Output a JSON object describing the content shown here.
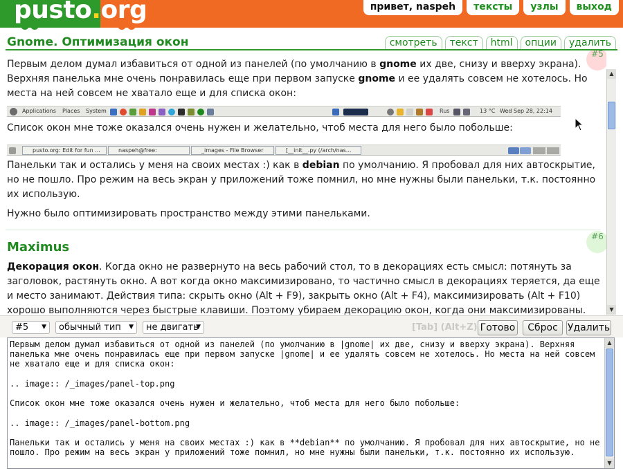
{
  "header": {
    "logo": {
      "part1": "pusto",
      "dot": ".",
      "part2": "org"
    },
    "nav": {
      "greeting": "привет, naspeh",
      "texts": "тексты",
      "nodes": "узлы",
      "logout": "выход"
    }
  },
  "doc": {
    "title": "Gnome. Оптимизация окон",
    "actions": {
      "view": "смотреть",
      "text": "текст",
      "html": "html",
      "options": "опции",
      "delete": "удалить"
    }
  },
  "content": {
    "badge5": "#5",
    "badge6": "#6",
    "p1a": "Первым делом думал избавиться от одной из панелей (по умолчанию в ",
    "p1b": "gnome",
    "p1c": " их две, снизу и вверху экрана). Верхняя панелька мне очень понравилась еще при первом запуске ",
    "p1d": "gnome",
    "p1e": " и ее удалять совсем не хотелось. Но места на ней совсем не хватало еще и для списка окон:",
    "p2": "Список окон мне тоже оказался очень нужен и желательно, чтоб места для него было побольше:",
    "p3a": "Панельки так и остались у меня на своих местах :) как в ",
    "p3b": "debian",
    "p3c": " по умолчанию. Я пробовал для них автоскрытие, но не пошло. Про режим на весь экран у приложений тоже помнил, но мне нужны были панельки, т.к. постоянно их использую.",
    "p4": "Нужно было оптимизировать пространство между этими панельками.",
    "h2": "Maximus",
    "p5a": "Декорация окон",
    "p5b": ". Когда окно не развернуто на весь рабочий стол, то в декорациях есть смысл: потянуть за заголовок, растянуть окно. А вот когда окно максимизировано, то частично смысл в декорациях теряется, да еще и место занимают. Действия типа: скрыть окно (Alt + F9), закрыть окно (Alt + F4), максимизировать (Alt + F10) хорошо выполняются через быстрые клавиши. Поэтому убираем декорацию окон, когда они максимизированы. Для этого"
  },
  "panel_top": {
    "applications": "Applications",
    "places": "Places",
    "system": "System",
    "layout": "Rus",
    "temp": "13 °C",
    "clock": "Wed Sep 28, 22:14"
  },
  "panel_bottom": {
    "task1": "pusto.org: Edit for fun ...",
    "task2": "naspeh@free:",
    "task3": "_images - File Browser",
    "task4": "[__init__.py (/arch/nas..."
  },
  "editor_bar": {
    "block_select": "#5",
    "type_select": "обычный тип",
    "move_select": "не двигать",
    "hotkeys": "[Tab] (Alt+Z)",
    "done": "Готово",
    "reset": "Сброс",
    "delete": "Удалить"
  },
  "editor": {
    "source": "Первым делом думал избавиться от одной из панелей (по умолчанию в |gnome| их две, снизу и вверху экрана). Верхняя панелька мне очень понравилась еще при первом запуске |gnome| и ее удалять совсем не хотелось. Но места на ней совсем не хватало еще и для списка окон:\n\n.. image:: /_images/panel-top.png\n\nСписок окон мне тоже оказался очень нужен и желательно, чтоб места для него было побольше:\n\n.. image:: /_images/panel-bottom.png\n\nПанельки так и остались у меня на своих местах :) как в **debian** по умолчанию. Я пробовал для них автоскрытие, но не пошло. Про режим на весь экран у приложений тоже помнил, но мне нужны были панельки, т.к. постоянно их использую.\n\nНужно было"
  },
  "colors": {
    "brand_green": "#2f9a2c",
    "brand_orange": "#f16a23",
    "link_green": "#218a21"
  }
}
